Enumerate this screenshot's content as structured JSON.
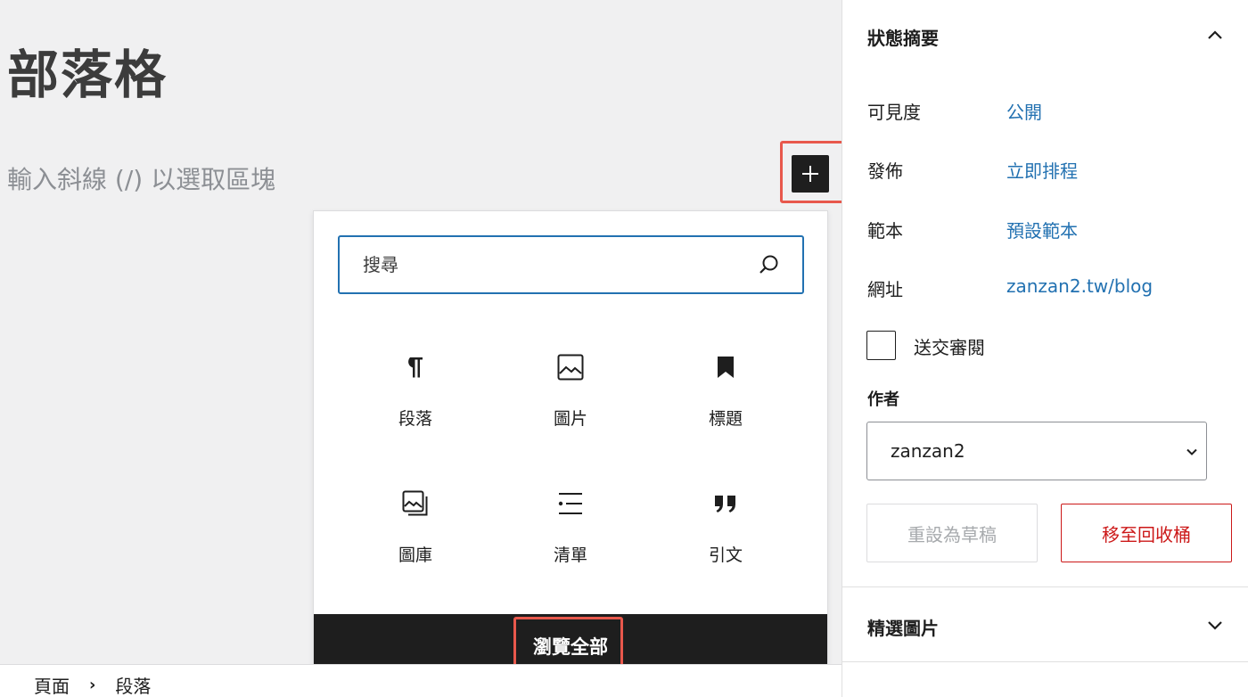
{
  "editor": {
    "title": "部落格",
    "placeholder": "輸入斜線 (/) 以選取區塊"
  },
  "inserter": {
    "search_placeholder": "搜尋",
    "blocks": [
      {
        "label": "段落",
        "icon": "paragraph-icon"
      },
      {
        "label": "圖片",
        "icon": "image-icon"
      },
      {
        "label": "標題",
        "icon": "heading-bookmark-icon"
      },
      {
        "label": "圖庫",
        "icon": "gallery-icon"
      },
      {
        "label": "清單",
        "icon": "list-icon"
      },
      {
        "label": "引文",
        "icon": "quote-icon"
      }
    ],
    "browse_all": "瀏覽全部"
  },
  "breadcrumb": [
    "頁面",
    "段落"
  ],
  "sidebar": {
    "status_panel": {
      "title": "狀態摘要",
      "rows": [
        {
          "label": "可見度",
          "value": "公開"
        },
        {
          "label": "發佈",
          "value": "立即排程"
        },
        {
          "label": "範本",
          "value": "預設範本"
        },
        {
          "label": "網址",
          "value": "zanzan2.tw/blog"
        }
      ],
      "pending_review": "送交審閱",
      "author_label": "作者",
      "author_value": "zanzan2",
      "draft_button": "重設為草稿",
      "trash_button": "移至回收桶"
    },
    "featured_image_title": "精選圖片"
  },
  "colors": {
    "accent": "#2271b1",
    "danger": "#cc1818",
    "highlight": "#e8584c",
    "dark": "#1e1e1e"
  }
}
